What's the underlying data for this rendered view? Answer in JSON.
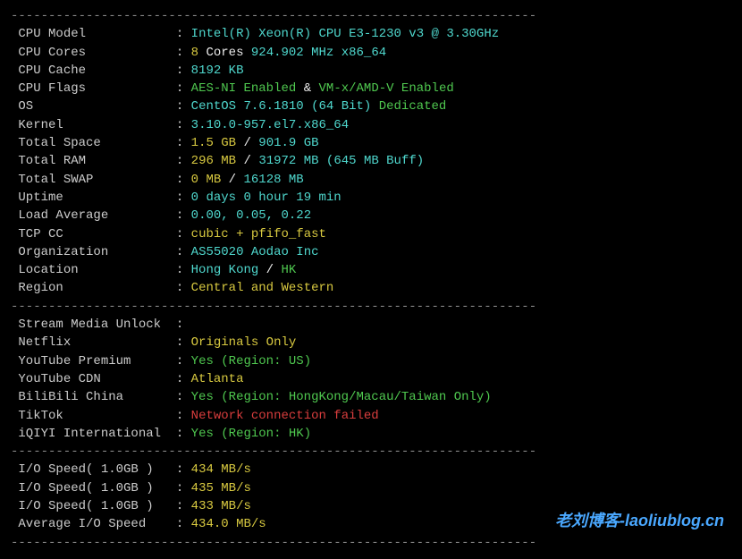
{
  "divider": "----------------------------------------------------------------------",
  "labels": {
    "cpu_model": "CPU Model",
    "cpu_cores": "CPU Cores",
    "cpu_cache": "CPU Cache",
    "cpu_flags": "CPU Flags",
    "os": "OS",
    "kernel": "Kernel",
    "total_space": "Total Space",
    "total_ram": "Total RAM",
    "total_swap": "Total SWAP",
    "uptime": "Uptime",
    "load_avg": "Load Average",
    "tcp_cc": "TCP CC",
    "org": "Organization",
    "location": "Location",
    "region": "Region",
    "stream": "Stream Media Unlock",
    "netflix": "Netflix",
    "yt_premium": "YouTube Premium",
    "yt_cdn": "YouTube CDN",
    "bilibili": "BiliBili China",
    "tiktok": "TikTok",
    "iqiyi": "iQIYI International",
    "io1": "I/O Speed( 1.0GB )",
    "io2": "I/O Speed( 1.0GB )",
    "io3": "I/O Speed( 1.0GB )",
    "io_avg": "Average I/O Speed"
  },
  "values": {
    "cpu_model": "Intel(R) Xeon(R) CPU E3-1230 v3 @ 3.30GHz",
    "cpu_cores_count": "8",
    "cpu_cores_suffix": " Cores ",
    "cpu_freq": "924.902 MHz x86_64",
    "cpu_cache": "8192 KB",
    "cpu_flags_a": "AES-NI Enabled",
    "cpu_flags_amp": " & ",
    "cpu_flags_b": "VM-x/AMD-V Enabled",
    "os": "CentOS 7.6.1810 (64 Bit)",
    "os_type": " Dedicated",
    "kernel": "3.10.0-957.el7.x86_64",
    "space_used": "1.5 GB",
    "slash": " / ",
    "space_total": "901.9 GB",
    "ram_used": "296 MB",
    "ram_total": "31972 MB",
    "ram_buff": " (645 MB Buff)",
    "swap_used": "0 MB",
    "swap_total": "16128 MB",
    "uptime": "0 days 0 hour 19 min",
    "load_avg": "0.00, 0.05, 0.22",
    "tcp_cc": "cubic + pfifo_fast",
    "org": "AS55020 Aodao Inc",
    "loc_city": "Hong Kong",
    "loc_cc": "HK",
    "region": "Central and Western",
    "netflix": "Originals Only",
    "yt_premium": "Yes (Region: US)",
    "yt_cdn": "Atlanta",
    "bilibili": "Yes (Region: HongKong/Macau/Taiwan Only)",
    "tiktok": "Network connection failed",
    "iqiyi": "Yes (Region: HK)",
    "io1": "434 MB/s",
    "io2": "435 MB/s",
    "io3": "433 MB/s",
    "io_avg": "434.0 MB/s"
  },
  "watermark": "老刘博客-laoliublog.cn"
}
